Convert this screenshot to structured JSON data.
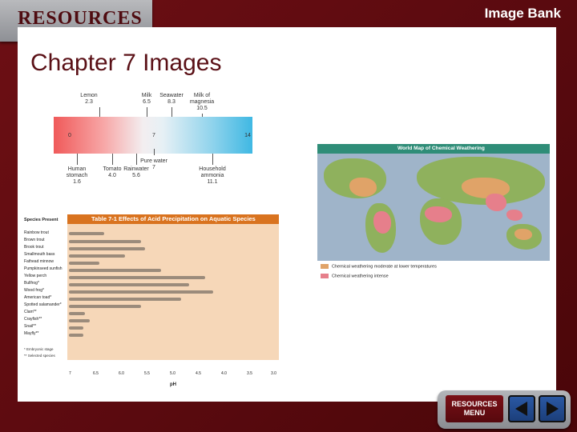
{
  "header": {
    "banner": "RESOURCES",
    "section": "Image Bank"
  },
  "slide": {
    "title": "Chapter 7 Images"
  },
  "ph_scale": {
    "top_labels": [
      {
        "name": "Lemon",
        "value": "2.3"
      },
      {
        "name": "Milk",
        "value": "6.5"
      },
      {
        "name": "Seawater",
        "value": "8.3"
      },
      {
        "name": "Milk of magnesia",
        "value": "10.5"
      }
    ],
    "bottom_labels": [
      {
        "name": "Human stomach",
        "value": "1.6"
      },
      {
        "name": "Tomato",
        "value": "4.0"
      },
      {
        "name": "Rainwater",
        "value": "5.6"
      },
      {
        "name": "Pure water",
        "value": "7"
      },
      {
        "name": "Household ammonia",
        "value": "11.1"
      }
    ],
    "min": "0",
    "mid": "7",
    "max": "14"
  },
  "table_fig": {
    "title": "Table 7-1  Effects of Acid Precipitation on Aquatic Species",
    "col_head": "Species Present",
    "species": [
      "Rainbow trout",
      "Brown trout",
      "Brook trout",
      "Smallmouth bass",
      "Fathead minnow",
      "Pumpkinseed sunfish",
      "Yellow perch",
      "Bullfrog*",
      "Wood frog*",
      "American toad*",
      "Spotted salamander*",
      "Clam**",
      "Crayfish**",
      "Snail**",
      "Mayfly**"
    ],
    "footnotes": [
      "* Embryonic stage",
      "** Selected species"
    ],
    "x_ticks": [
      "7",
      "6.5",
      "6.0",
      "5.5",
      "5.0",
      "4.5",
      "4.0",
      "3.5",
      "3.0"
    ],
    "x_label": "pH"
  },
  "map_fig": {
    "title": "World Map of Chemical Weathering",
    "legend": [
      {
        "label": "Chemical weathering moderate at lower temperatures",
        "color": "#e0a368"
      },
      {
        "label": "Chemical weathering intense",
        "color": "#e67f8b"
      }
    ]
  },
  "nav": {
    "menu_line1": "RESOURCES",
    "menu_line2": "MENU"
  }
}
